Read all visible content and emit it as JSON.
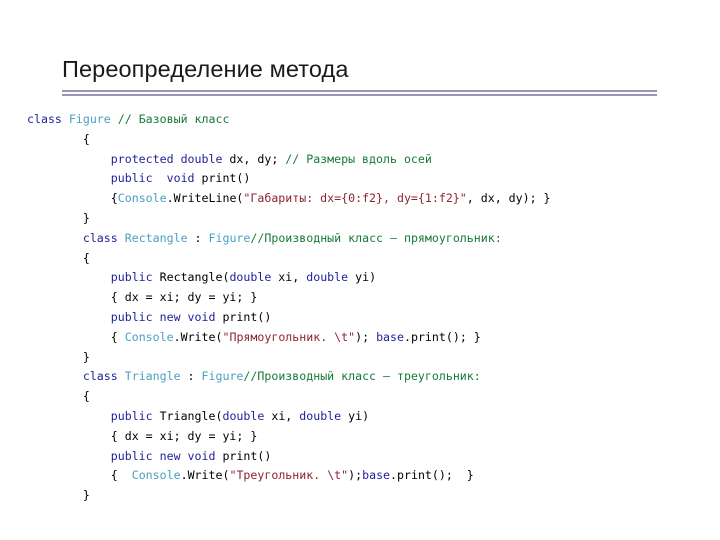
{
  "slide": {
    "title": "Переопределение метода",
    "divider_color": "#9896b8",
    "background": "#ffffff"
  },
  "syntax_colors": {
    "keyword": "#1f1f9b",
    "type": "#4aa0c0",
    "comment": "#157a38",
    "string": "#8e2433",
    "plain": "#000000"
  },
  "code": {
    "language": "csharp",
    "lines": [
      {
        "indent": 0,
        "tokens": [
          {
            "t": "class",
            "c": "kw"
          },
          {
            "t": " ",
            "c": "pln"
          },
          {
            "t": "Figure",
            "c": "type"
          },
          {
            "t": " ",
            "c": "pln"
          },
          {
            "t": "// Базовый класс",
            "c": "cmt"
          }
        ]
      },
      {
        "indent": 8,
        "tokens": [
          {
            "t": "{",
            "c": "pln"
          }
        ]
      },
      {
        "indent": 12,
        "tokens": [
          {
            "t": "protected double",
            "c": "kw"
          },
          {
            "t": " dx, dy; ",
            "c": "pln"
          },
          {
            "t": "// Размеры вдоль осей",
            "c": "cmt"
          }
        ]
      },
      {
        "indent": 12,
        "tokens": [
          {
            "t": "public  void",
            "c": "kw"
          },
          {
            "t": " print()",
            "c": "pln"
          }
        ]
      },
      {
        "indent": 12,
        "tokens": [
          {
            "t": "{",
            "c": "pln"
          },
          {
            "t": "Console",
            "c": "type"
          },
          {
            "t": ".WriteLine(",
            "c": "pln"
          },
          {
            "t": "\"Габариты: dx={0:f2}, dy={1:f2}\"",
            "c": "str"
          },
          {
            "t": ", dx, dy); }",
            "c": "pln"
          }
        ]
      },
      {
        "indent": 8,
        "tokens": [
          {
            "t": "}",
            "c": "pln"
          }
        ]
      },
      {
        "indent": 8,
        "tokens": [
          {
            "t": "class",
            "c": "kw"
          },
          {
            "t": " ",
            "c": "pln"
          },
          {
            "t": "Rectangle",
            "c": "type"
          },
          {
            "t": " : ",
            "c": "pln"
          },
          {
            "t": "Figure",
            "c": "type"
          },
          {
            "t": "//Производный класс – прямоугольник:",
            "c": "cmt"
          }
        ]
      },
      {
        "indent": 8,
        "tokens": [
          {
            "t": "{",
            "c": "pln"
          }
        ]
      },
      {
        "indent": 12,
        "tokens": [
          {
            "t": "public",
            "c": "kw"
          },
          {
            "t": " Rectangle(",
            "c": "pln"
          },
          {
            "t": "double",
            "c": "kw"
          },
          {
            "t": " xi, ",
            "c": "pln"
          },
          {
            "t": "double",
            "c": "kw"
          },
          {
            "t": " yi)",
            "c": "pln"
          }
        ]
      },
      {
        "indent": 12,
        "tokens": [
          {
            "t": "{ dx = xi; dy = yi; }",
            "c": "pln"
          }
        ]
      },
      {
        "indent": 12,
        "tokens": [
          {
            "t": "public new void",
            "c": "kw"
          },
          {
            "t": " print()",
            "c": "pln"
          }
        ]
      },
      {
        "indent": 12,
        "tokens": [
          {
            "t": "{ ",
            "c": "pln"
          },
          {
            "t": "Console",
            "c": "type"
          },
          {
            "t": ".Write(",
            "c": "pln"
          },
          {
            "t": "\"Прямоугольник. \\t\"",
            "c": "str"
          },
          {
            "t": "); ",
            "c": "pln"
          },
          {
            "t": "base",
            "c": "kw"
          },
          {
            "t": ".print(); }",
            "c": "pln"
          }
        ]
      },
      {
        "indent": 8,
        "tokens": [
          {
            "t": "}",
            "c": "pln"
          }
        ]
      },
      {
        "indent": 8,
        "tokens": [
          {
            "t": "class",
            "c": "kw"
          },
          {
            "t": " ",
            "c": "pln"
          },
          {
            "t": "Triangle",
            "c": "type"
          },
          {
            "t": " : ",
            "c": "pln"
          },
          {
            "t": "Figure",
            "c": "type"
          },
          {
            "t": "//Производный класс – треугольник:",
            "c": "cmt"
          }
        ]
      },
      {
        "indent": 8,
        "tokens": [
          {
            "t": "{",
            "c": "pln"
          }
        ]
      },
      {
        "indent": 12,
        "tokens": [
          {
            "t": "public",
            "c": "kw"
          },
          {
            "t": " Triangle(",
            "c": "pln"
          },
          {
            "t": "double",
            "c": "kw"
          },
          {
            "t": " xi, ",
            "c": "pln"
          },
          {
            "t": "double",
            "c": "kw"
          },
          {
            "t": " yi)",
            "c": "pln"
          }
        ]
      },
      {
        "indent": 12,
        "tokens": [
          {
            "t": "{ dx = xi; dy = yi; }",
            "c": "pln"
          }
        ]
      },
      {
        "indent": 12,
        "tokens": [
          {
            "t": "public new void",
            "c": "kw"
          },
          {
            "t": " print()",
            "c": "pln"
          }
        ]
      },
      {
        "indent": 12,
        "tokens": [
          {
            "t": "{  ",
            "c": "pln"
          },
          {
            "t": "Console",
            "c": "type"
          },
          {
            "t": ".Write(",
            "c": "pln"
          },
          {
            "t": "\"Треугольник. \\t\"",
            "c": "str"
          },
          {
            "t": ");",
            "c": "pln"
          },
          {
            "t": "base",
            "c": "kw"
          },
          {
            "t": ".print();  }",
            "c": "pln"
          }
        ]
      },
      {
        "indent": 8,
        "tokens": [
          {
            "t": "}",
            "c": "pln"
          }
        ]
      }
    ]
  }
}
